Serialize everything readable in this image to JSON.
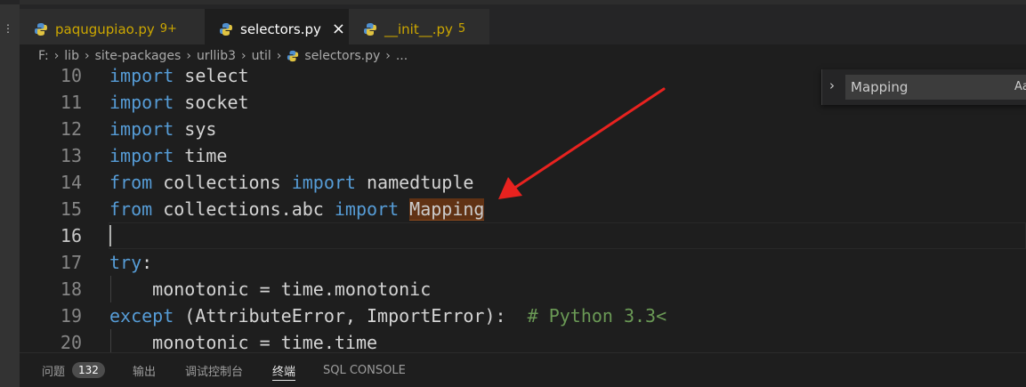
{
  "tabs": [
    {
      "name": "paqugupiao.py",
      "badge": "9+",
      "color": "#cca700",
      "active": false
    },
    {
      "name": "selectors.py",
      "badge": "",
      "color": "#ffffff",
      "active": true
    },
    {
      "name": "__init__.py",
      "badge": "5",
      "color": "#cca700",
      "active": false
    }
  ],
  "tab_close_icon": "×",
  "breadcrumb": [
    "F:",
    "lib",
    "site-packages",
    "urllib3",
    "util",
    "selectors.py",
    "..."
  ],
  "find": {
    "value": "Mapping",
    "option_label": "Aa"
  },
  "code_lines": [
    {
      "num": "10",
      "tokens": [
        {
          "t": "import",
          "c": "kw"
        },
        {
          "t": " select",
          "c": "id"
        }
      ]
    },
    {
      "num": "11",
      "tokens": [
        {
          "t": "import",
          "c": "kw"
        },
        {
          "t": " socket",
          "c": "id"
        }
      ]
    },
    {
      "num": "12",
      "tokens": [
        {
          "t": "import",
          "c": "kw"
        },
        {
          "t": " sys",
          "c": "id"
        }
      ]
    },
    {
      "num": "13",
      "tokens": [
        {
          "t": "import",
          "c": "kw"
        },
        {
          "t": " time",
          "c": "id"
        }
      ]
    },
    {
      "num": "14",
      "tokens": [
        {
          "t": "from",
          "c": "kw"
        },
        {
          "t": " collections ",
          "c": "id"
        },
        {
          "t": "import",
          "c": "kw"
        },
        {
          "t": " namedtuple",
          "c": "id"
        }
      ]
    },
    {
      "num": "15",
      "tokens": [
        {
          "t": "from",
          "c": "kw"
        },
        {
          "t": " collections.abc ",
          "c": "id"
        },
        {
          "t": "import",
          "c": "kw"
        },
        {
          "t": " ",
          "c": "id"
        },
        {
          "t": "Mapping",
          "c": "hl"
        }
      ]
    },
    {
      "num": "16",
      "tokens": []
    },
    {
      "num": "17",
      "tokens": [
        {
          "t": "try",
          "c": "kw"
        },
        {
          "t": ":",
          "c": "id"
        }
      ]
    },
    {
      "num": "18",
      "tokens": [
        {
          "t": "    monotonic = time.monotonic",
          "c": "id"
        }
      ]
    },
    {
      "num": "19",
      "tokens": [
        {
          "t": "except",
          "c": "kw"
        },
        {
          "t": " (AttributeError, ImportError):  ",
          "c": "id"
        },
        {
          "t": "# Python 3.3<",
          "c": "cm"
        }
      ]
    },
    {
      "num": "20",
      "tokens": [
        {
          "t": "    monotonic = time.time",
          "c": "id"
        }
      ]
    }
  ],
  "current_line": "16",
  "panel_tabs": [
    {
      "label": "问题",
      "count": "132",
      "active": false
    },
    {
      "label": "输出",
      "count": "",
      "active": false
    },
    {
      "label": "调试控制台",
      "count": "",
      "active": false
    },
    {
      "label": "终端",
      "count": "",
      "active": true
    },
    {
      "label": "SQL CONSOLE",
      "count": "",
      "active": false
    }
  ],
  "colors": {
    "keyword": "#569cd6",
    "identifier": "#d4d4d4",
    "comment": "#6a9955",
    "highlight": "#613214",
    "arrow": "#e8221f",
    "warning": "#cca700"
  },
  "icons": {
    "file_type": "python-icon",
    "find_toggle": "chevron-right-icon",
    "annotation": "red-arrow"
  }
}
